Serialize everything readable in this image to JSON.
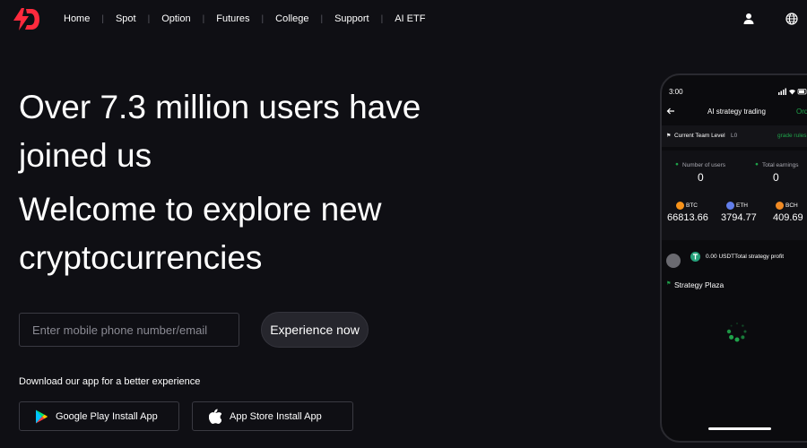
{
  "nav": {
    "items": [
      "Home",
      "Spot",
      "Option",
      "Futures",
      "College",
      "Support",
      "AI ETF"
    ],
    "separator": "|"
  },
  "hero": {
    "line1": "Over 7.3 million users have",
    "line2": "joined us",
    "line3": "Welcome to explore new",
    "line4": "cryptocurrencies"
  },
  "signup": {
    "placeholder": "Enter mobile phone number/email",
    "button_label": "Experience now"
  },
  "download": {
    "text": "Download our app for a better experience",
    "google_label": "Google Play Install App",
    "apple_label": "App Store Install App"
  },
  "phone": {
    "time": "3:00",
    "title": "AI strategy trading",
    "title_right": "Ord",
    "team_level_label": "Current Team Level",
    "team_level_value": "L0",
    "grade_rules": "grade rules",
    "users_label": "Number of users",
    "users_value": "0",
    "earnings_label": "Total earnings",
    "earnings_value": "0",
    "coins": [
      {
        "name": "BTC",
        "price": "66813.66",
        "color": "#f7931a"
      },
      {
        "name": "ETH",
        "price": "3794.77",
        "color": "#627eea"
      },
      {
        "name": "BCH",
        "price": "409.69",
        "color": "#f08a24"
      }
    ],
    "profit_text": "0.00 USDTTotal strategy profit",
    "plaza_label": "Strategy Plaza"
  },
  "colors": {
    "background": "#0f0f14",
    "logo_red": "#ff2a3d",
    "accent_green": "#1fa34a"
  },
  "icons": [
    "logo-icon",
    "user-icon",
    "globe-icon",
    "google-play-icon",
    "apple-icon",
    "back-arrow-icon",
    "loading-spinner-icon"
  ]
}
